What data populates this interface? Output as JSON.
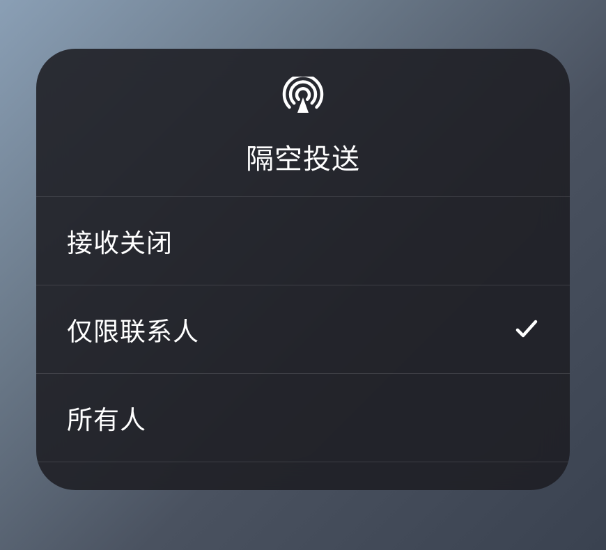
{
  "header": {
    "title": "隔空投送",
    "icon_name": "airdrop-icon"
  },
  "options": [
    {
      "label": "接收关闭",
      "selected": false
    },
    {
      "label": "仅限联系人",
      "selected": true
    },
    {
      "label": "所有人",
      "selected": false
    }
  ]
}
